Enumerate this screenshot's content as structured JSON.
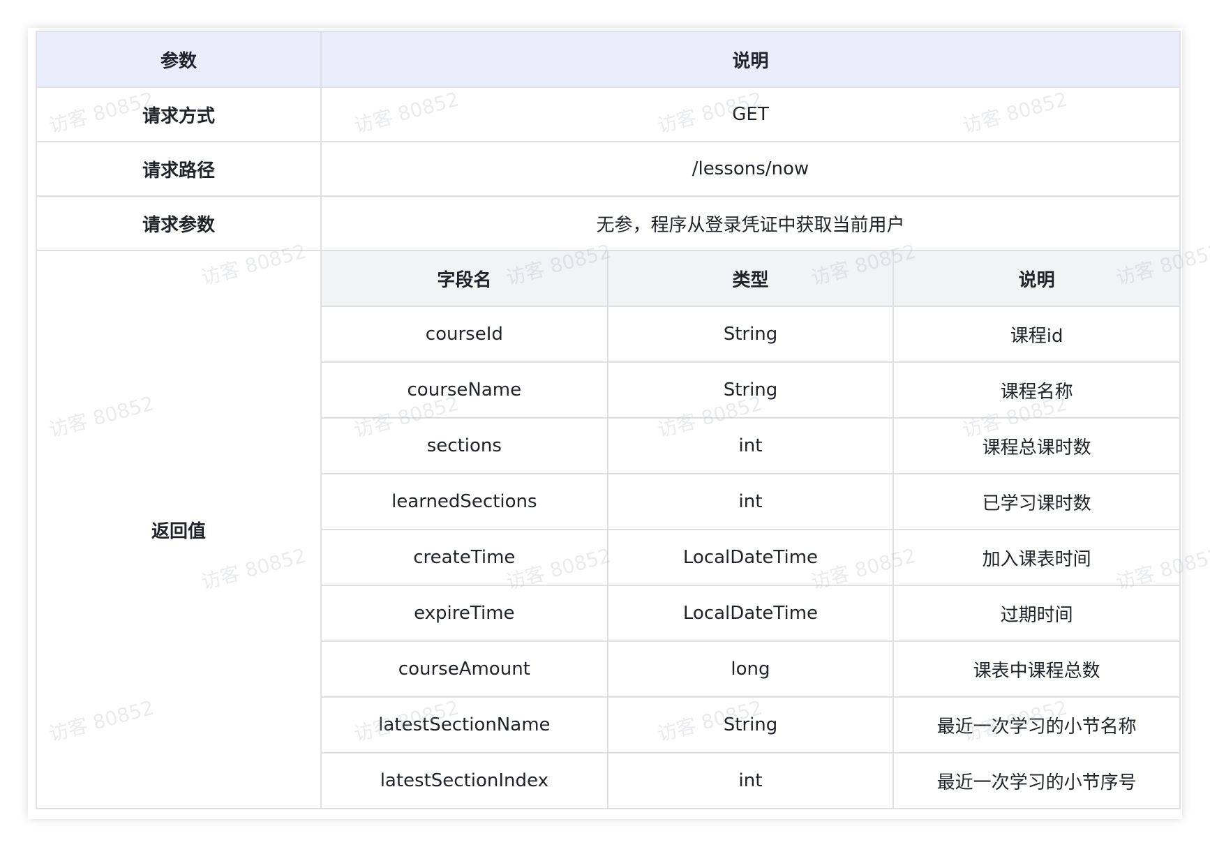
{
  "header": {
    "param": "参数",
    "desc": "说明"
  },
  "rows": [
    {
      "param": "请求方式",
      "value": "GET"
    },
    {
      "param": "请求路径",
      "value": "/lessons/now"
    },
    {
      "param": "请求参数",
      "value": "无参，程序从登录凭证中获取当前用户"
    }
  ],
  "return_value": {
    "param": "返回值",
    "columns": [
      "字段名",
      "类型",
      "说明"
    ],
    "fields": [
      {
        "name": "courseId",
        "type": "String",
        "desc": "课程id"
      },
      {
        "name": "courseName",
        "type": "String",
        "desc": "课程名称"
      },
      {
        "name": "sections",
        "type": "int",
        "desc": "课程总课时数"
      },
      {
        "name": "learnedSections",
        "type": "int",
        "desc": "已学习课时数"
      },
      {
        "name": "createTime",
        "type": "LocalDateTime",
        "desc": "加入课表时间"
      },
      {
        "name": "expireTime",
        "type": "LocalDateTime",
        "desc": "过期时间"
      },
      {
        "name": "courseAmount",
        "type": "long",
        "desc": "课表中课程总数"
      },
      {
        "name": "latestSectionName",
        "type": "String",
        "desc": "最近一次学习的小节名称"
      },
      {
        "name": "latestSectionIndex",
        "type": "int",
        "desc": "最近一次学习的小节序号"
      }
    ]
  },
  "watermark": "访客 80852",
  "colors": {
    "header_bg": "#eaedfc",
    "subheader_bg": "#f2f3f5",
    "border": "#dee0e3",
    "text": "#1f2329"
  }
}
